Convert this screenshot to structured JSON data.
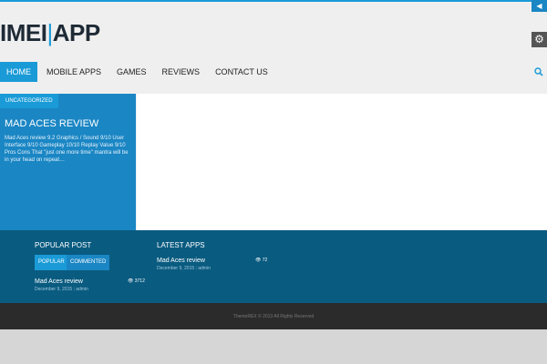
{
  "header": {
    "logo_part1": "IMEI",
    "logo_part2": "APP"
  },
  "nav": {
    "items": [
      {
        "label": "HOME"
      },
      {
        "label": "MOBILE APPS"
      },
      {
        "label": "GAMES"
      },
      {
        "label": "REVIEWS"
      },
      {
        "label": "CONTACT US"
      }
    ]
  },
  "featured": {
    "category": "UNCATEGORIZED",
    "title": "MAD ACES REVIEW",
    "excerpt": "Mad Aces review 9.2 Graphics / Sound 9/10 User Interface 9/10 Gameplay 10/10 Replay Value 9/10 Pros Cons     That \"just one more time\" mantra will be in your head on repeat…"
  },
  "popular_post": {
    "title": "POPULAR POST",
    "tabs": [
      "POPULAR",
      "COMMENTED"
    ],
    "entry": {
      "title": "Mad Aces review",
      "date": "December 9, 2015",
      "author": "admin",
      "views": "3712"
    }
  },
  "latest_apps": {
    "title": "LATEST APPS",
    "entry": {
      "title": "Mad Aces review",
      "date": "December 9, 2015",
      "author": "admin",
      "views": "72"
    }
  },
  "footer": {
    "copyright": "ThemeREX © 2013 All Rights Reserved"
  },
  "colors": {
    "accent": "#1a9bd7",
    "panel": "#1a86c4",
    "footer_widgets": "#0a5b80",
    "copyright_bar": "#2b2b2b"
  }
}
